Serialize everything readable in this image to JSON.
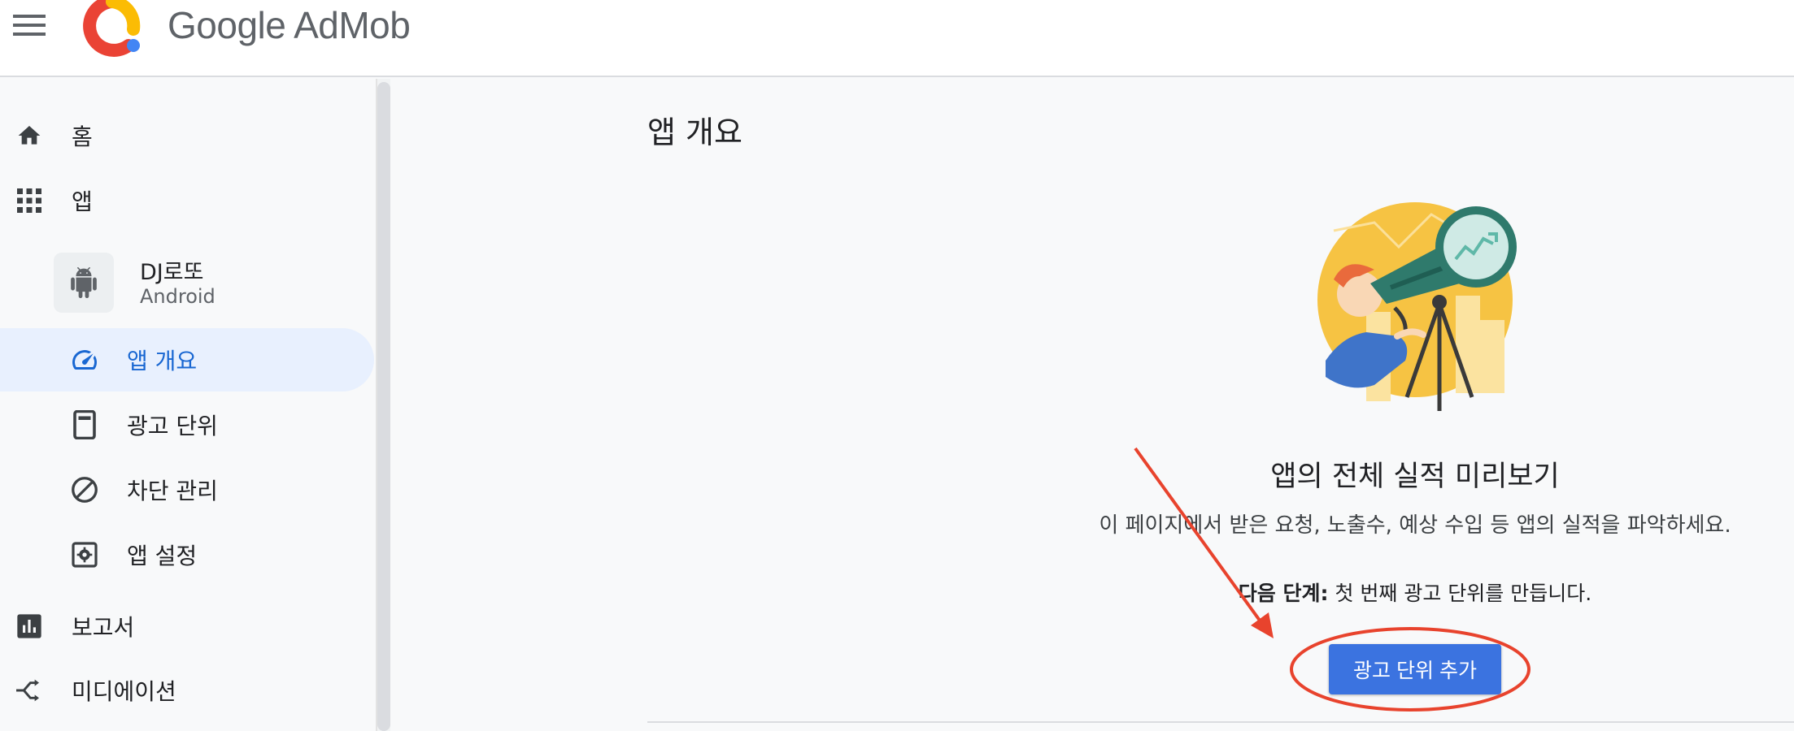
{
  "header": {
    "brand": "Google AdMob",
    "brand_colors": {
      "red": "#ea4335",
      "yellow": "#fbbc04",
      "blue": "#4285f4"
    }
  },
  "sidebar": {
    "items": [
      {
        "label": "홈",
        "icon": "home-icon"
      },
      {
        "label": "앱",
        "icon": "apps-grid-icon"
      },
      {
        "label": "앱 개요",
        "icon": "speedometer-icon",
        "active": true
      },
      {
        "label": "광고 단위",
        "icon": "phone-ad-icon"
      },
      {
        "label": "차단 관리",
        "icon": "block-icon"
      },
      {
        "label": "앱 설정",
        "icon": "settings-box-icon"
      },
      {
        "label": "보고서",
        "icon": "bar-chart-icon"
      },
      {
        "label": "미디에이션",
        "icon": "mediation-icon"
      }
    ],
    "app": {
      "name": "DJ로또",
      "platform": "Android",
      "icon": "android-icon"
    },
    "active_color": "#1967d2",
    "active_bg": "#e8f0fe"
  },
  "main": {
    "page_title": "앱 개요",
    "hero_title": "앱의 전체 실적 미리보기",
    "hero_desc": "이 페이지에서 받은 요청, 노출수, 예상 수입 등 앱의 실적을 파악하세요.",
    "next_step_label": "다음 단계:",
    "next_step_text": " 첫 번째 광고 단위를 만듭니다.",
    "add_button": "광고 단위 추가",
    "button_color": "#3b73e0",
    "annotation_color": "#e8432d"
  }
}
